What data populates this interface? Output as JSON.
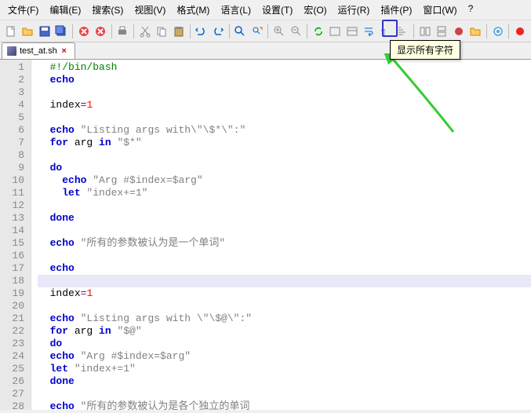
{
  "menu": {
    "file": "文件(F)",
    "edit": "编辑(E)",
    "search": "搜索(S)",
    "view": "视图(V)",
    "format": "格式(M)",
    "lang": "语言(L)",
    "settings": "设置(T)",
    "macro": "宏(O)",
    "run": "运行(R)",
    "plugins": "插件(P)",
    "window": "窗口(W)",
    "help": "?"
  },
  "tab": {
    "filename": "test_at.sh"
  },
  "tooltip": "显示所有字符",
  "gutter": [
    "1",
    "2",
    "3",
    "4",
    "5",
    "6",
    "7",
    "8",
    "9",
    "10",
    "11",
    "12",
    "13",
    "14",
    "15",
    "16",
    "17",
    "18",
    "19",
    "20",
    "21",
    "22",
    "23",
    "24",
    "25",
    "26",
    "27",
    "28"
  ],
  "code": {
    "l1_cm": "#!/bin/bash",
    "l2_kw": "echo",
    "l4_v": "index",
    "l4_n": "1",
    "l6_kw": "echo",
    "l6_s": " \"Listing args with\\\"\\$*\\\":\"",
    "l7_for": "for",
    "l7_mid": " arg ",
    "l7_in": "in",
    "l7_s": " \"$*\"",
    "l9_do": "do",
    "l10_kw": "echo",
    "l10_s": " \"Arg #$index=$arg\"",
    "l11_let": "let",
    "l11_s": " \"index+=1\"",
    "l13_done": "done",
    "l15_kw": "echo",
    "l15_s": " \"所有的参数被认为是一个单词\"",
    "l17_kw": "echo",
    "l19_v": "index",
    "l19_n": "1",
    "l21_kw": "echo",
    "l21_s": " \"Listing args with \\\"\\$@\\\":\"",
    "l22_for": "for",
    "l22_mid": " arg ",
    "l22_in": "in",
    "l22_s": " \"$@\"",
    "l23_do": "do",
    "l24_kw": "echo",
    "l24_s": " \"Arg #$index=$arg\"",
    "l25_let": "let",
    "l25_s": " \"index+=1\"",
    "l26_done": "done",
    "l28_kw": "echo",
    "l28_s": " \"所有的参数被认为是各个独立的单词"
  }
}
